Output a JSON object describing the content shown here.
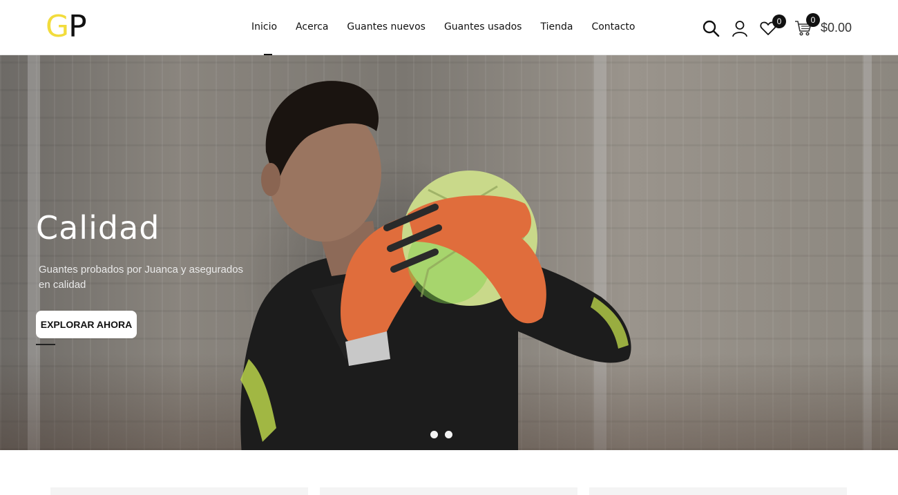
{
  "brand": {
    "logo_g": "G",
    "logo_p": "P",
    "logo_g_color": "#f2dc3c",
    "logo_p_color": "#111111"
  },
  "nav": {
    "items": [
      {
        "label": "Inicio",
        "active": true
      },
      {
        "label": "Acerca",
        "active": false
      },
      {
        "label": "Guantes nuevos",
        "active": false
      },
      {
        "label": "Guantes usados",
        "active": false
      },
      {
        "label": "Tienda",
        "active": false
      },
      {
        "label": "Contacto",
        "active": false
      }
    ]
  },
  "header_icons": {
    "search": "search-icon",
    "account": "user-icon",
    "wishlist": "heart-icon",
    "wishlist_count": "0",
    "cart": "cart-icon",
    "cart_count": "0",
    "cart_total": "$0.00"
  },
  "hero": {
    "title": "Calidad",
    "subtitle": "Guantes probados por Juanca y asegurados en calidad",
    "cta_label": "EXPLORAR AHORA",
    "slides": 2,
    "active_slide": 1
  },
  "colors": {
    "accent": "#f2dc3c",
    "text": "#111111",
    "badge_bg": "#111111"
  }
}
